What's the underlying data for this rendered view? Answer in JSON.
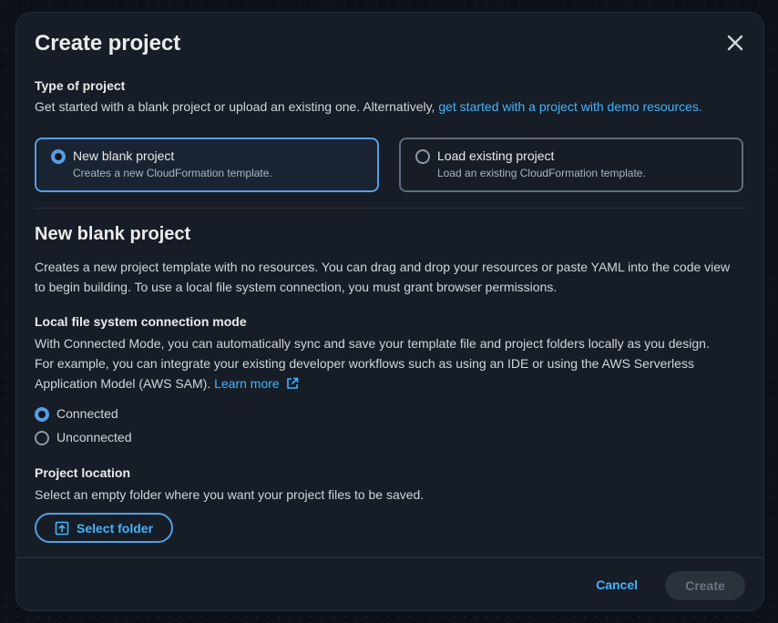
{
  "modal": {
    "title": "Create project",
    "close_icon": "close-icon"
  },
  "type_of_project": {
    "label": "Type of project",
    "description": "Get started with a blank project or upload an existing one. Alternatively, ",
    "demo_link": "get started with a project with demo resources.",
    "options": [
      {
        "title": "New blank project",
        "description": "Creates a new CloudFormation template.",
        "selected": true
      },
      {
        "title": "Load existing project",
        "description": "Load an existing CloudFormation template.",
        "selected": false
      }
    ]
  },
  "blank_project": {
    "heading": "New blank project",
    "description_line1": "Creates a new project template with no resources. You can drag and drop your resources or paste YAML into the code view",
    "description_line2": "to begin building. To use a local file system connection, you must grant browser permissions."
  },
  "connection_mode": {
    "label": "Local file system connection mode",
    "line1": "With Connected Mode, you can automatically sync and save your template file and project folders locally as you design.",
    "line2": "For example, you can integrate your existing developer workflows such as using an IDE or using the AWS Serverless",
    "line3": "Application Model (AWS SAM). ",
    "learn_more": "Learn more",
    "options": [
      {
        "label": "Connected",
        "selected": true
      },
      {
        "label": "Unconnected",
        "selected": false
      }
    ]
  },
  "project_location": {
    "label": "Project location",
    "description": "Select an empty folder where you want your project files to be saved.",
    "button_label": "Select folder"
  },
  "footer": {
    "cancel_label": "Cancel",
    "create_label": "Create"
  },
  "colors": {
    "accent": "#539fe5",
    "link": "#42b4ff",
    "background": "#161d26"
  }
}
